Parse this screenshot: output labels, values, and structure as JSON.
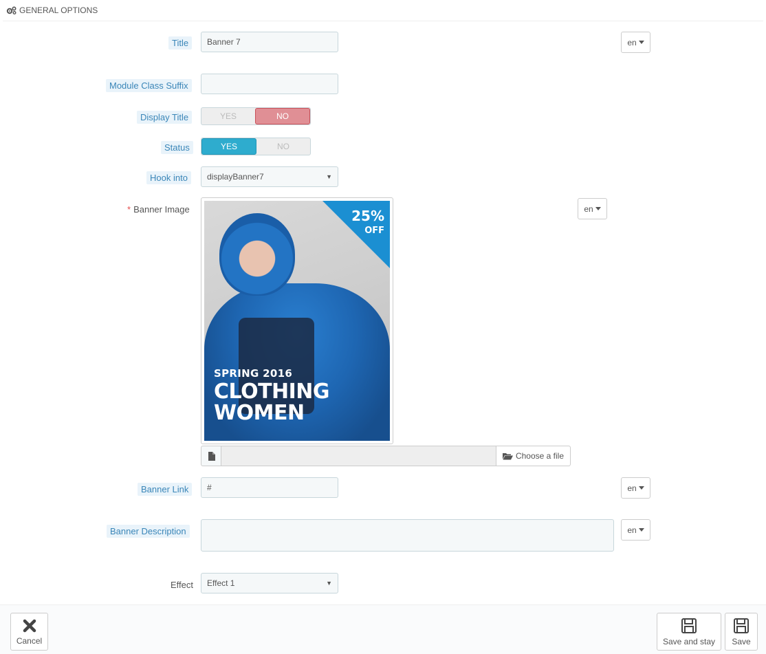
{
  "panel": {
    "heading": "GENERAL OPTIONS"
  },
  "fields": {
    "title": {
      "label": "Title",
      "value": "Banner 7",
      "lang": "en"
    },
    "module_class_suffix": {
      "label": "Module Class Suffix",
      "value": ""
    },
    "display_title": {
      "label": "Display Title",
      "yes": "YES",
      "no": "NO",
      "selected": "NO"
    },
    "status": {
      "label": "Status",
      "yes": "YES",
      "no": "NO",
      "selected": "YES"
    },
    "hook_into": {
      "label": "Hook into",
      "value": "displayBanner7"
    },
    "banner_image": {
      "label": "Banner Image",
      "required_mark": "*",
      "lang": "en",
      "image_text": {
        "discount": "25%",
        "discount_sub": "OFF",
        "season": "SPRING 2016",
        "headline_1": "CLOTHING",
        "headline_2": "WOMEN"
      },
      "choose_file_label": "Choose a file",
      "file_name": ""
    },
    "banner_link": {
      "label": "Banner Link",
      "value": "#",
      "lang": "en"
    },
    "banner_description": {
      "label": "Banner Description",
      "value": "",
      "lang": "en"
    },
    "effect": {
      "label": "Effect",
      "value": "Effect 1"
    }
  },
  "footer": {
    "cancel_label": "Cancel",
    "save_and_stay_label": "Save and stay",
    "save_label": "Save"
  }
}
